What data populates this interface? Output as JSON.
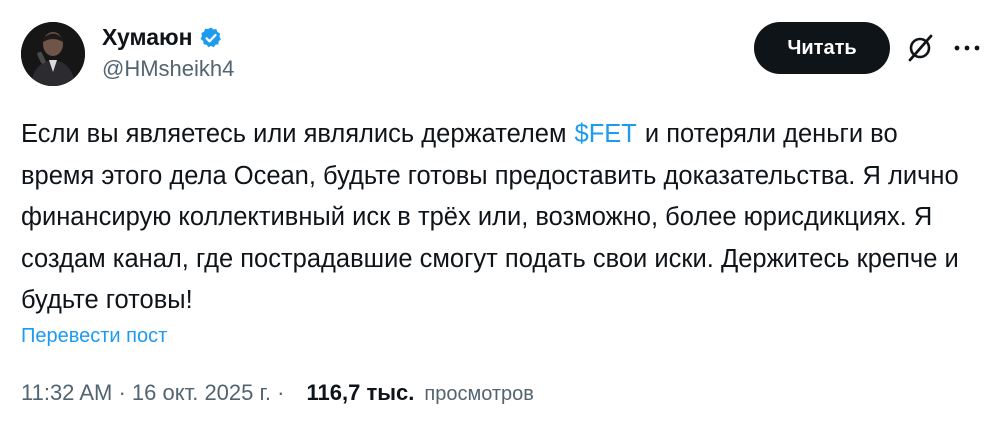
{
  "author": {
    "name": "Хумаюн",
    "handle": "@HMsheikh4",
    "avatar_icon": "person-with-microphone-avatar",
    "verified_icon": "verified-badge-icon",
    "verified_color": "#1d9bf0"
  },
  "actions": {
    "follow_label": "Читать",
    "grok_icon": "grok-icon",
    "more_icon": "more-dots-icon"
  },
  "tweet": {
    "text_before": "Если вы являетесь или являлись держателем",
    "cashtag": "$FET",
    "text_after": "и потеряли деньги во время этого дела Ocean, будьте готовы предоставить доказательства. Я лично финансирую коллективный иск в трёх или, возможно, более юрисдикциях. Я создам канал, где пострадавшие смогут подать свои иски. Держитесь крепче и будьте готовы!",
    "translate_label": "Перевести пост"
  },
  "meta": {
    "time": "11:32 AM",
    "sep1": " · ",
    "date": "16 окт. 2025 г.",
    "sep2": " · ",
    "views_count": "116,7 тыс.",
    "views_label": "просмотров"
  },
  "colors": {
    "accent": "#1d9bf0",
    "text": "#0f1419",
    "secondary": "#536471",
    "button_bg": "#0f1419"
  }
}
